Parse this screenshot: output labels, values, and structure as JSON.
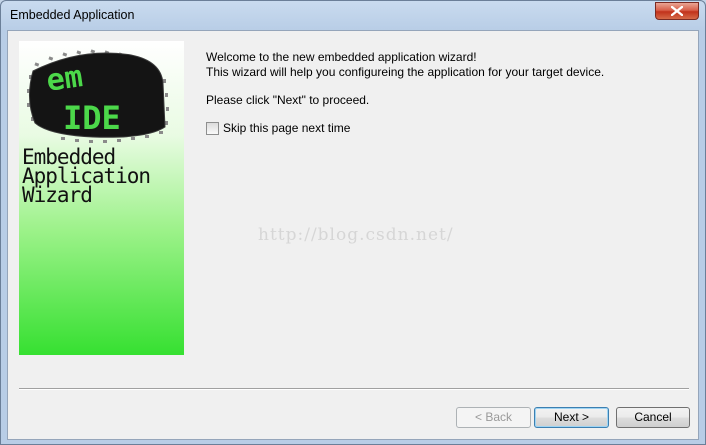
{
  "window": {
    "title": "Embedded Application"
  },
  "banner": {
    "chip_text_line1": "em",
    "chip_text_line2": "IDE",
    "caption_lines": [
      "Embedded",
      "Application",
      "Wizard"
    ]
  },
  "content": {
    "welcome_line1": "Welcome to the new embedded application wizard!",
    "welcome_line2": "This wizard will help you configureing the application for your target device.",
    "instruction": "Please click \"Next\" to proceed.",
    "skip_checkbox_label": "Skip this page next time",
    "skip_checked": false
  },
  "watermark": "http://blog.csdn.net/",
  "buttons": {
    "back": "< Back",
    "next": "Next >",
    "cancel": "Cancel"
  },
  "colors": {
    "banner_green": "#36e031",
    "chip_text": "#4cd84a",
    "close_red": "#c1321c"
  }
}
